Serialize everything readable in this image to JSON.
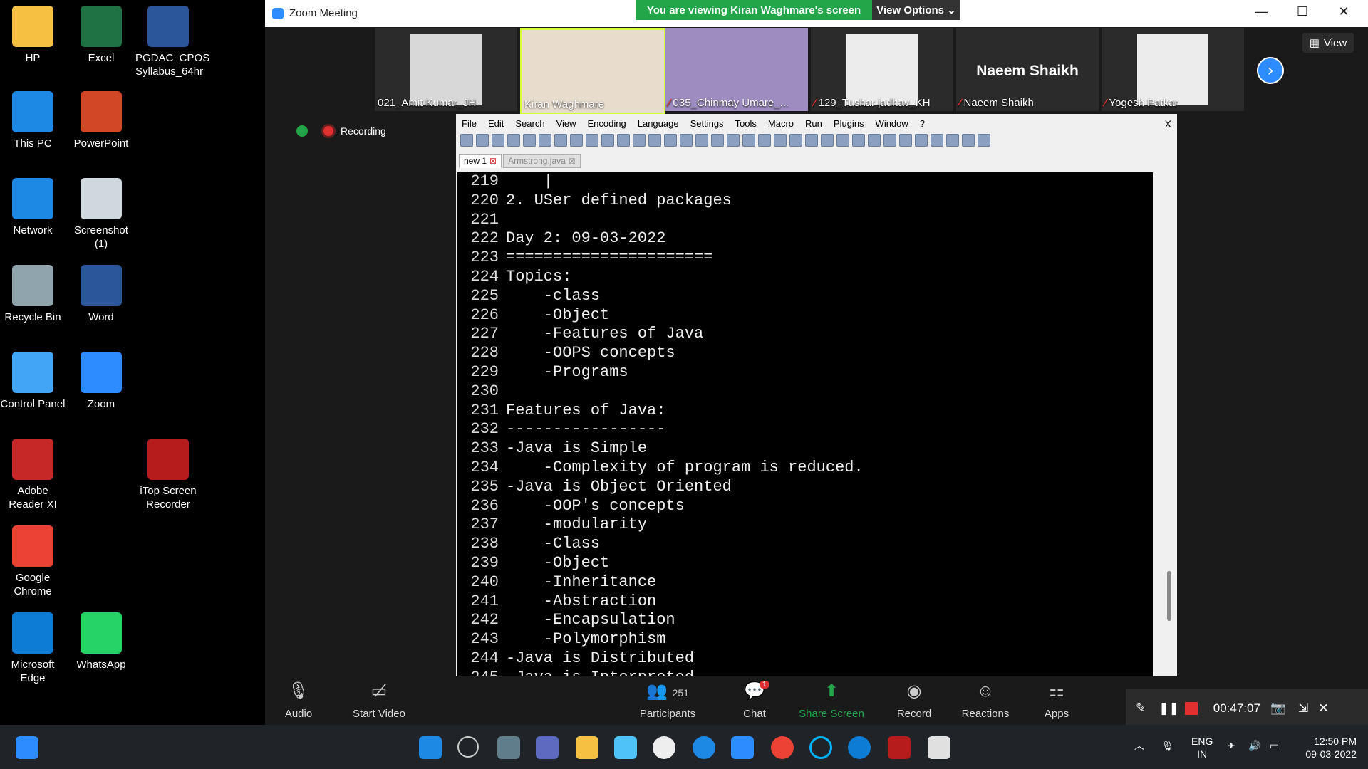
{
  "desktop": {
    "icons": [
      {
        "label": "HP",
        "icon": "folder-icon",
        "color": "#f6c142"
      },
      {
        "label": "Excel",
        "icon": "excel-icon",
        "color": "#1f7244"
      },
      {
        "label": "PGDAC_CPOS\nSyllabus_64hr",
        "icon": "word-doc-icon",
        "color": "#2b579a"
      },
      {
        "label": "This PC",
        "icon": "computer-icon",
        "color": "#1e88e5"
      },
      {
        "label": "PowerPoint",
        "icon": "powerpoint-icon",
        "color": "#d24726"
      },
      {
        "label": "Network",
        "icon": "network-icon",
        "color": "#1e88e5"
      },
      {
        "label": "Screenshot\n(1)",
        "icon": "screenshot-icon",
        "color": "#cfd8dc"
      },
      {
        "label": "Recycle Bin",
        "icon": "recycle-bin-icon",
        "color": "#90a4ae"
      },
      {
        "label": "Word",
        "icon": "word-icon",
        "color": "#2b579a"
      },
      {
        "label": "Control Panel",
        "icon": "control-panel-icon",
        "color": "#42a5f5"
      },
      {
        "label": "Zoom",
        "icon": "zoom-icon",
        "color": "#2d8cff"
      },
      {
        "label": "Adobe\nReader XI",
        "icon": "adobe-reader-icon",
        "color": "#c62828"
      },
      {
        "label": "iTop Screen\nRecorder",
        "icon": "screen-recorder-icon",
        "color": "#b71c1c"
      },
      {
        "label": "Google\nChrome",
        "icon": "chrome-icon",
        "color": "#ea4335"
      },
      {
        "label": "Microsoft\nEdge",
        "icon": "edge-icon",
        "color": "#0c7cd5"
      },
      {
        "label": "WhatsApp",
        "icon": "whatsapp-icon",
        "color": "#25d366"
      }
    ]
  },
  "zoom": {
    "window_title": "Zoom Meeting",
    "banner": "You are viewing Kiran Waghmare's screen",
    "view_options": "View Options ⌄",
    "view_button": "View",
    "recording": "Recording",
    "participants": [
      {
        "name": "021_Amit Kumar_JH",
        "muted": false
      },
      {
        "name": "Kiran Waghmare",
        "muted": false
      },
      {
        "name": "035_Chinmay Umare_...",
        "muted": true
      },
      {
        "name": "129_Tushar jadhav_KH",
        "muted": true
      },
      {
        "name": "Naeem Shaikh",
        "muted": true,
        "display_text": "Naeem Shaikh"
      },
      {
        "name": "Yogesh Patkar",
        "muted": true
      }
    ],
    "toolbar": {
      "audio": "Audio",
      "start_video": "Start Video",
      "participants": "Participants",
      "participants_count": "251",
      "chat": "Chat",
      "chat_badge": "1",
      "share_screen": "Share Screen",
      "record": "Record",
      "reactions": "Reactions",
      "apps": "Apps"
    },
    "record_timer": "00:47:07"
  },
  "notepad": {
    "menu": [
      "File",
      "Edit",
      "Search",
      "View",
      "Encoding",
      "Language",
      "Settings",
      "Tools",
      "Macro",
      "Run",
      "Plugins",
      "Window",
      "?"
    ],
    "close": "X",
    "tabs": [
      "new 1",
      "Armstrong.java"
    ],
    "lines": [
      {
        "n": "219",
        "t": "    |"
      },
      {
        "n": "220",
        "t": "2. USer defined packages"
      },
      {
        "n": "221",
        "t": ""
      },
      {
        "n": "222",
        "t": "Day 2: 09-03-2022"
      },
      {
        "n": "223",
        "t": "======================"
      },
      {
        "n": "224",
        "t": "Topics:"
      },
      {
        "n": "225",
        "t": "    -class"
      },
      {
        "n": "226",
        "t": "    -Object"
      },
      {
        "n": "227",
        "t": "    -Features of Java"
      },
      {
        "n": "228",
        "t": "    -OOPS concepts"
      },
      {
        "n": "229",
        "t": "    -Programs"
      },
      {
        "n": "230",
        "t": ""
      },
      {
        "n": "231",
        "t": "Features of Java:"
      },
      {
        "n": "232",
        "t": "-----------------"
      },
      {
        "n": "233",
        "t": "-Java is Simple"
      },
      {
        "n": "234",
        "t": "    -Complexity of program is reduced."
      },
      {
        "n": "235",
        "t": "-Java is Object Oriented"
      },
      {
        "n": "236",
        "t": "    -OOP's concepts"
      },
      {
        "n": "237",
        "t": "    -modularity"
      },
      {
        "n": "238",
        "t": "    -Class"
      },
      {
        "n": "239",
        "t": "    -Object"
      },
      {
        "n": "240",
        "t": "    -Inheritance"
      },
      {
        "n": "241",
        "t": "    -Abstraction"
      },
      {
        "n": "242",
        "t": "    -Encapsulation"
      },
      {
        "n": "243",
        "t": "    -Polymorphism"
      },
      {
        "n": "244",
        "t": "-Java is Distributed"
      },
      {
        "n": "245",
        "t": "-Java is Interpreted"
      }
    ]
  },
  "taskbar": {
    "lang": "ENG",
    "region": "IN",
    "time": "12:50 PM",
    "date": "09-03-2022"
  }
}
